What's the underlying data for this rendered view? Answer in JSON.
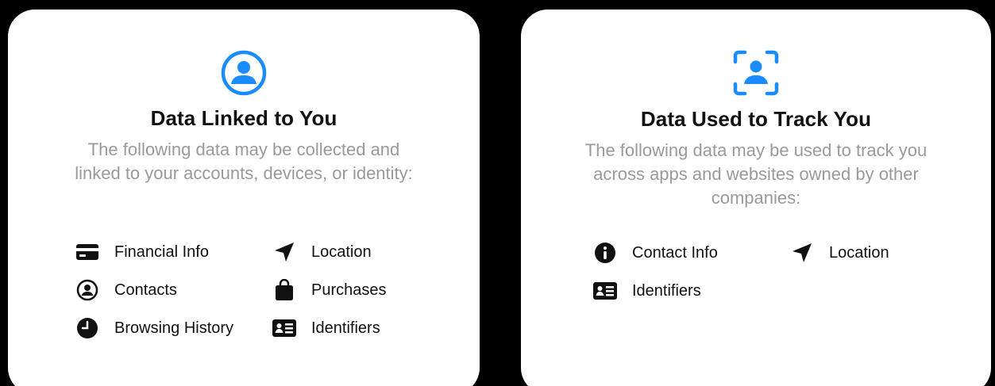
{
  "colors": {
    "accent": "#1a8cff",
    "title": "#111111",
    "description": "#9a9a9a",
    "card": "#ffffff",
    "background": "#000000"
  },
  "cards": [
    {
      "hero_icon": "person-circle-icon",
      "title": "Data Linked to You",
      "description": "The following data may be collected and linked to your accounts, devices, or identity:",
      "items": [
        {
          "label": "Financial Info",
          "icon": "credit-card-icon"
        },
        {
          "label": "Location",
          "icon": "location-arrow-icon"
        },
        {
          "label": "Contacts",
          "icon": "person-circle-outline-icon"
        },
        {
          "label": "Purchases",
          "icon": "shopping-bag-icon"
        },
        {
          "label": "Browsing History",
          "icon": "clock-icon"
        },
        {
          "label": "Identifiers",
          "icon": "id-card-icon"
        }
      ]
    },
    {
      "hero_icon": "person-viewfinder-icon",
      "title": "Data Used to Track You",
      "description": "The following data may be used to track you across apps and websites owned by other companies:",
      "items": [
        {
          "label": "Contact Info",
          "icon": "info-circle-icon"
        },
        {
          "label": "Location",
          "icon": "location-arrow-icon"
        },
        {
          "label": "Identifiers",
          "icon": "id-card-icon"
        }
      ]
    }
  ]
}
